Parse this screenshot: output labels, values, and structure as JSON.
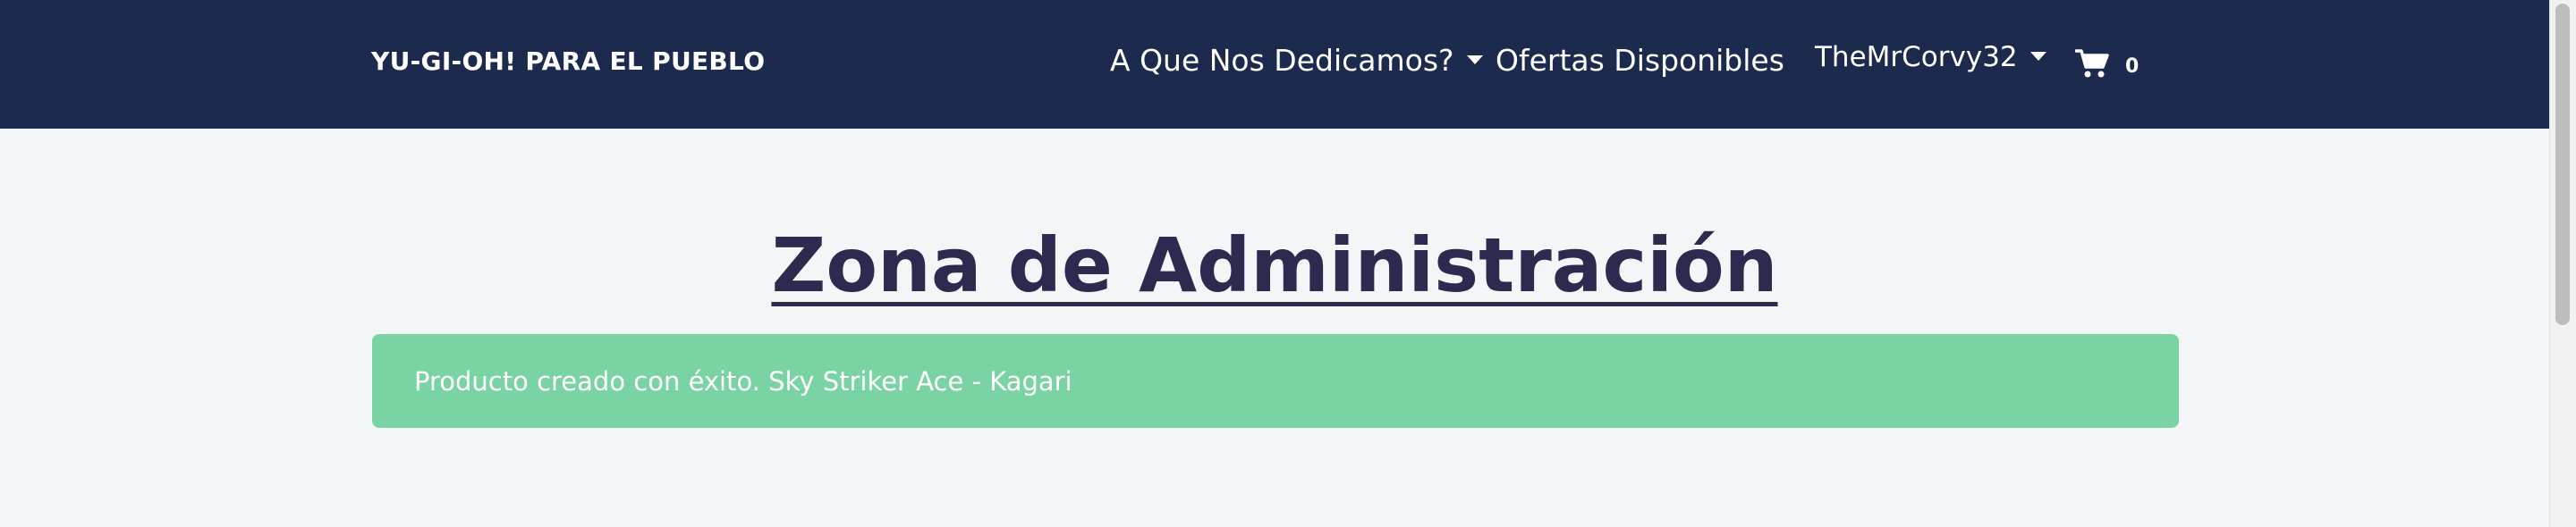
{
  "navbar": {
    "brand": "YU-GI-OH! PARA EL PUEBLO",
    "items": [
      {
        "label": "A Que Nos Dedicamos?"
      },
      {
        "label": "Ofertas Disponibles"
      },
      {
        "label": "TheMrCorvy32"
      }
    ],
    "cart": {
      "icon": "cart-icon",
      "count": "0"
    }
  },
  "main": {
    "title": "Zona de Administración",
    "alert": "Producto creado con éxito. Sky Striker Ace - Kagari"
  },
  "colors": {
    "navbar_bg": "#1c2a4d",
    "page_bg": "#f4f5f7",
    "title": "#2d2a4f",
    "alert_bg": "#7ad3a3"
  }
}
